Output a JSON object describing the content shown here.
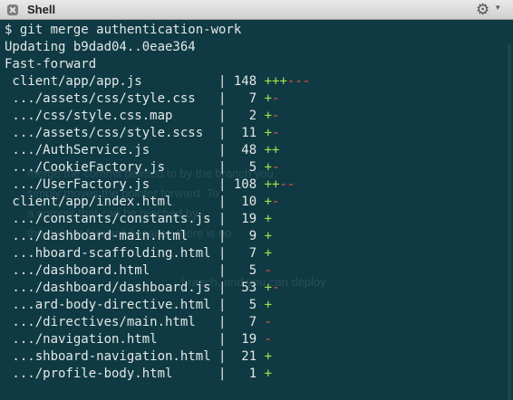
{
  "window": {
    "title": "Shell",
    "gear_icon": "⚙",
    "chevron_icon": "▾"
  },
  "colors": {
    "background": "#0f3a44",
    "text": "#e4e7e6",
    "plus": "#a7e349",
    "minus": "#ff4f3a"
  },
  "terminal": {
    "lines": [
      "$ git merge authentication-work",
      "Updating b9dad04..0eae364",
      "Fast-forward"
    ],
    "files": [
      {
        "path": " client/app/app.js",
        "sep": "|",
        "count": "148",
        "plus": "+++",
        "minus": "---"
      },
      {
        "path": " .../assets/css/style.css",
        "sep": "|",
        "count": "7",
        "plus": "+",
        "minus": "-"
      },
      {
        "path": " .../css/style.css.map",
        "sep": "|",
        "count": "2",
        "plus": "+",
        "minus": "-"
      },
      {
        "path": " .../assets/css/style.scss",
        "sep": "|",
        "count": "11",
        "plus": "+",
        "minus": "-"
      },
      {
        "path": " .../AuthService.js",
        "sep": "|",
        "count": "48",
        "plus": "++",
        "minus": ""
      },
      {
        "path": " .../CookieFactory.js",
        "sep": "|",
        "count": "5",
        "plus": "+",
        "minus": "-"
      },
      {
        "path": " .../UserFactory.js",
        "sep": "|",
        "count": "108",
        "plus": "++",
        "minus": "--"
      },
      {
        "path": " client/app/index.html",
        "sep": "|",
        "count": "10",
        "plus": "+",
        "minus": "-"
      },
      {
        "path": " .../constants/constants.js",
        "sep": "|",
        "count": "19",
        "plus": "+",
        "minus": ""
      },
      {
        "path": " .../dashboard-main.html",
        "sep": "|",
        "count": "9",
        "plus": "+",
        "minus": ""
      },
      {
        "path": " ...hboard-scaffolding.html",
        "sep": "|",
        "count": "7",
        "plus": "+",
        "minus": ""
      },
      {
        "path": " .../dashboard.html",
        "sep": "|",
        "count": "5",
        "plus": "",
        "minus": "-"
      },
      {
        "path": " .../dashboard/dashboard.js",
        "sep": "|",
        "count": "53",
        "plus": "+",
        "minus": "-"
      },
      {
        "path": " ...ard-body-directive.html",
        "sep": "|",
        "count": "5",
        "plus": "+",
        "minus": ""
      },
      {
        "path": " .../directives/main.html",
        "sep": "|",
        "count": "7",
        "plus": "",
        "minus": "-"
      },
      {
        "path": " .../navigation.html",
        "sep": "|",
        "count": "19",
        "plus": "",
        "minus": "-"
      },
      {
        "path": " ...shboard-navigation.html",
        "sep": "|",
        "count": "21",
        "plus": "+",
        "minus": ""
      },
      {
        "path": " .../profile-body.html",
        "sep": "|",
        "count": "1",
        "plus": "+",
        "minus": ""
      }
    ]
  },
  "background_ghost": {
    "line1": "merge the commit pointed to by the branch you",
    "line2": "simply moves the pointer forward. To",
    "line3": "a commit that can be reached by",
    "line4": "the pointer forward because there is no",
    "line5": "branch, and you can deploy"
  }
}
